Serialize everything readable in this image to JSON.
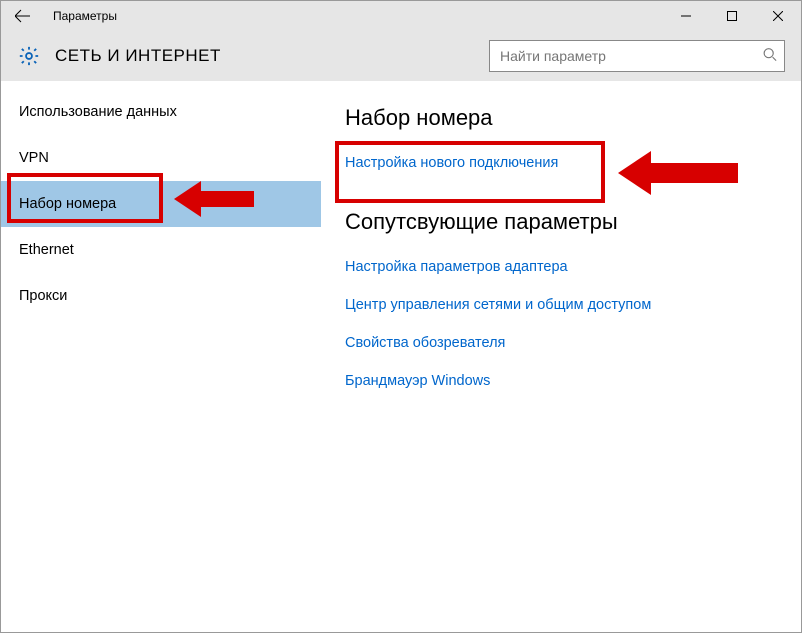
{
  "window": {
    "title": "Параметры"
  },
  "header": {
    "page_title": "СЕТЬ И ИНТЕРНЕТ",
    "search_placeholder": "Найти параметр"
  },
  "sidebar": {
    "items": [
      {
        "label": "Использование данных"
      },
      {
        "label": "VPN"
      },
      {
        "label": "Набор номера",
        "selected": true
      },
      {
        "label": "Ethernet"
      },
      {
        "label": "Прокси"
      }
    ]
  },
  "main": {
    "heading1": "Набор номера",
    "link1": "Настройка нового подключения",
    "heading2": "Сопутсвующие параметры",
    "related_links": [
      "Настройка параметров адаптера",
      "Центр управления сетями и общим доступом",
      "Свойства обозревателя",
      "Брандмауэр Windows"
    ]
  },
  "colors": {
    "accent_red": "#d70000",
    "link_blue": "#0066cc",
    "selection_blue": "#9fc7e6",
    "gear_blue": "#0a63b8"
  }
}
